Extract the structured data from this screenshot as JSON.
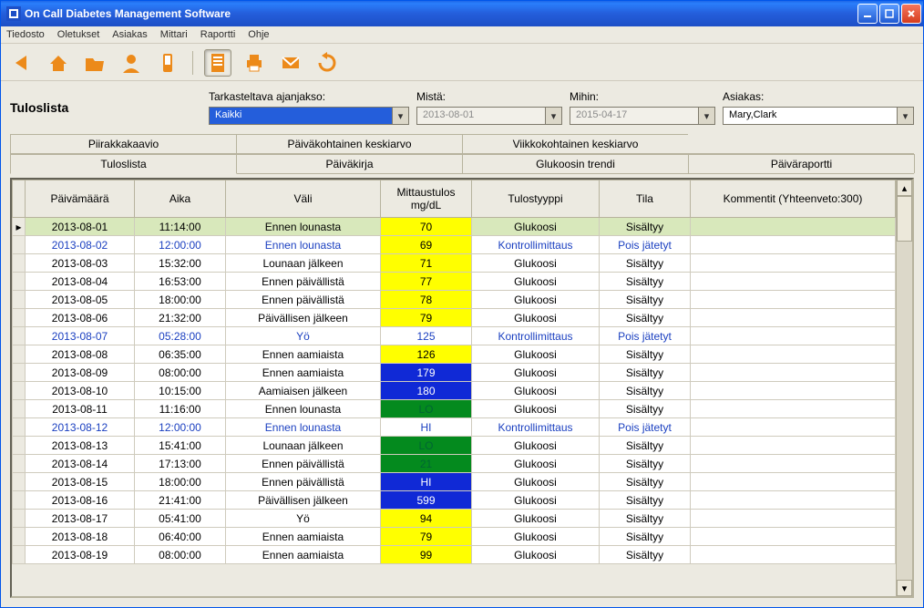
{
  "window": {
    "title": "On Call Diabetes Management Software"
  },
  "menu": {
    "items": [
      "Tiedosto",
      "Oletukset",
      "Asiakas",
      "Mittari",
      "Raportti",
      "Ohje"
    ]
  },
  "toolbar": {
    "icons": [
      "back",
      "home",
      "open-folder",
      "user",
      "phone",
      "separator",
      "document",
      "print",
      "email",
      "refresh"
    ]
  },
  "page": {
    "title": "Tuloslista"
  },
  "filters": {
    "period_label": "Tarkasteltava ajanjakso:",
    "period_value": "Kaikki",
    "from_label": "Mistä:",
    "from_value": "2013-08-01",
    "to_label": "Mihin:",
    "to_value": "2015-04-17",
    "client_label": "Asiakas:",
    "client_value": "Mary,Clark"
  },
  "tabs_top": [
    "Piirakkakaavio",
    "Päiväkohtainen keskiarvo",
    "Viikkokohtainen keskiarvo",
    ""
  ],
  "tabs_bottom": [
    "Tuloslista",
    "Päiväkirja",
    "Glukoosin trendi",
    "Päiväraportti"
  ],
  "tabs_bottom_selected": 0,
  "grid": {
    "columns": [
      "Päivämäärä",
      "Aika",
      "Väli",
      "Mittaustulos mg/dL",
      "Tulostyyppi",
      "Tila",
      "Kommentit (Yhteenveto:300)"
    ],
    "rows": [
      {
        "selected": true,
        "ctrl": false,
        "date": "2013-08-01",
        "time": "11:14:00",
        "interval": "Ennen lounasta",
        "result": "70",
        "result_bg": "yellow",
        "type": "Glukoosi",
        "status": "Sisältyy",
        "comment": ""
      },
      {
        "ctrl": true,
        "date": "2013-08-02",
        "time": "12:00:00",
        "interval": "Ennen lounasta",
        "result": "69",
        "result_bg": "yellow",
        "type": "Kontrollimittaus",
        "status": "Pois jätetyt",
        "comment": ""
      },
      {
        "date": "2013-08-03",
        "time": "15:32:00",
        "interval": "Lounaan jälkeen",
        "result": "71",
        "result_bg": "yellow",
        "type": "Glukoosi",
        "status": "Sisältyy",
        "comment": ""
      },
      {
        "date": "2013-08-04",
        "time": "16:53:00",
        "interval": "Ennen päivällistä",
        "result": "77",
        "result_bg": "yellow",
        "type": "Glukoosi",
        "status": "Sisältyy",
        "comment": ""
      },
      {
        "date": "2013-08-05",
        "time": "18:00:00",
        "interval": "Ennen päivällistä",
        "result": "78",
        "result_bg": "yellow",
        "type": "Glukoosi",
        "status": "Sisältyy",
        "comment": ""
      },
      {
        "date": "2013-08-06",
        "time": "21:32:00",
        "interval": "Päivällisen jälkeen",
        "result": "79",
        "result_bg": "yellow",
        "type": "Glukoosi",
        "status": "Sisältyy",
        "comment": ""
      },
      {
        "ctrl": true,
        "date": "2013-08-07",
        "time": "05:28:00",
        "interval": "Yö",
        "result": "125",
        "result_bg": "",
        "type": "Kontrollimittaus",
        "status": "Pois jätetyt",
        "comment": ""
      },
      {
        "date": "2013-08-08",
        "time": "06:35:00",
        "interval": "Ennen aamiaista",
        "result": "126",
        "result_bg": "yellow",
        "type": "Glukoosi",
        "status": "Sisältyy",
        "comment": ""
      },
      {
        "date": "2013-08-09",
        "time": "08:00:00",
        "interval": "Ennen aamiaista",
        "result": "179",
        "result_bg": "blue",
        "type": "Glukoosi",
        "status": "Sisältyy",
        "comment": ""
      },
      {
        "date": "2013-08-10",
        "time": "10:15:00",
        "interval": "Aamiaisen jälkeen",
        "result": "180",
        "result_bg": "blue",
        "type": "Glukoosi",
        "status": "Sisältyy",
        "comment": ""
      },
      {
        "date": "2013-08-11",
        "time": "11:16:00",
        "interval": "Ennen lounasta",
        "result": "LO",
        "result_bg": "green",
        "type": "Glukoosi",
        "status": "Sisältyy",
        "comment": ""
      },
      {
        "ctrl": true,
        "date": "2013-08-12",
        "time": "12:00:00",
        "interval": "Ennen lounasta",
        "result": "HI",
        "result_bg": "",
        "type": "Kontrollimittaus",
        "status": "Pois jätetyt",
        "comment": ""
      },
      {
        "date": "2013-08-13",
        "time": "15:41:00",
        "interval": "Lounaan jälkeen",
        "result": "LO",
        "result_bg": "green",
        "type": "Glukoosi",
        "status": "Sisältyy",
        "comment": ""
      },
      {
        "date": "2013-08-14",
        "time": "17:13:00",
        "interval": "Ennen päivällistä",
        "result": "21",
        "result_bg": "green",
        "type": "Glukoosi",
        "status": "Sisältyy",
        "comment": ""
      },
      {
        "date": "2013-08-15",
        "time": "18:00:00",
        "interval": "Ennen päivällistä",
        "result": "HI",
        "result_bg": "blue",
        "type": "Glukoosi",
        "status": "Sisältyy",
        "comment": ""
      },
      {
        "date": "2013-08-16",
        "time": "21:41:00",
        "interval": "Päivällisen jälkeen",
        "result": "599",
        "result_bg": "blue",
        "type": "Glukoosi",
        "status": "Sisältyy",
        "comment": ""
      },
      {
        "date": "2013-08-17",
        "time": "05:41:00",
        "interval": "Yö",
        "result": "94",
        "result_bg": "yellow",
        "type": "Glukoosi",
        "status": "Sisältyy",
        "comment": ""
      },
      {
        "date": "2013-08-18",
        "time": "06:40:00",
        "interval": "Ennen aamiaista",
        "result": "79",
        "result_bg": "yellow",
        "type": "Glukoosi",
        "status": "Sisältyy",
        "comment": ""
      },
      {
        "date": "2013-08-19",
        "time": "08:00:00",
        "interval": "Ennen aamiaista",
        "result": "99",
        "result_bg": "yellow",
        "type": "Glukoosi",
        "status": "Sisältyy",
        "comment": ""
      }
    ]
  }
}
